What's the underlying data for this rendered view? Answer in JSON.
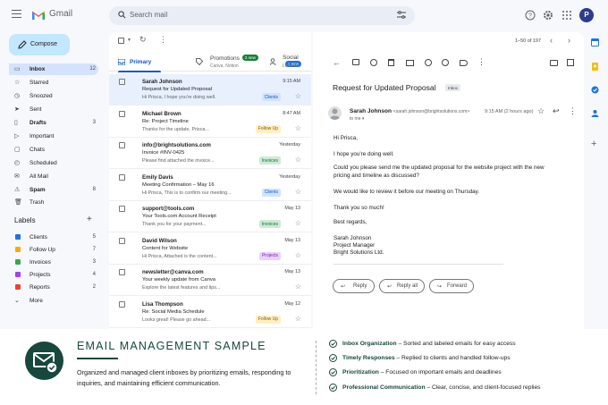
{
  "app": {
    "name": "Gmail",
    "search_placeholder": "Search mail",
    "avatar_letter": "P"
  },
  "sidebar": {
    "compose_label": "Compose",
    "items": [
      {
        "label": "Inbox",
        "count": "12",
        "icon": "inbox-icon",
        "active": true,
        "bold": true
      },
      {
        "label": "Starred",
        "count": "",
        "icon": "star-icon"
      },
      {
        "label": "Snoozed",
        "count": "",
        "icon": "clock-icon"
      },
      {
        "label": "Sent",
        "count": "",
        "icon": "send-icon"
      },
      {
        "label": "Drafts",
        "count": "3",
        "icon": "draft-icon",
        "bold": true
      },
      {
        "label": "Important",
        "count": "",
        "icon": "important-icon"
      },
      {
        "label": "Chats",
        "count": "",
        "icon": "chat-icon"
      },
      {
        "label": "Scheduled",
        "count": "",
        "icon": "scheduled-icon"
      },
      {
        "label": "All Mail",
        "count": "",
        "icon": "mail-icon"
      },
      {
        "label": "Spam",
        "count": "8",
        "icon": "spam-icon",
        "bold": true
      },
      {
        "label": "Trash",
        "count": "",
        "icon": "trash-icon"
      }
    ],
    "labels_heading": "Labels",
    "labels": [
      {
        "label": "Clients",
        "count": "5",
        "color": "#1a73e8"
      },
      {
        "label": "Follow Up",
        "count": "7",
        "color": "#f9ab00"
      },
      {
        "label": "Invoices",
        "count": "3",
        "color": "#34a853"
      },
      {
        "label": "Projects",
        "count": "4",
        "color": "#a142f4"
      },
      {
        "label": "Reports",
        "count": "2",
        "color": "#ea4335"
      }
    ],
    "more_label": "More"
  },
  "inbox": {
    "tabs": [
      {
        "label": "Primary",
        "sub": ""
      },
      {
        "label": "Promotions",
        "sub": "Canva, Notion",
        "badge": "2 new",
        "badge_color": "#188038"
      },
      {
        "label": "Social",
        "sub": "LinkedIn",
        "badge": "1 new",
        "badge_color": "#1a73e8"
      }
    ],
    "emails": [
      {
        "from": "Sarah Johnson",
        "subject": "Request for Updated Proposal",
        "snippet": "Hi Prisca, I hope you're doing well.",
        "time": "9:15 AM",
        "tag": "Clients",
        "tag_bg": "#d3e3fd",
        "tag_fg": "#0b57d0",
        "selected": true
      },
      {
        "from": "Michael Brown",
        "subject": "Re: Project Timeline",
        "snippet": "Thanks for the update, Prisca...",
        "time": "8:47 AM",
        "tag": "Follow Up",
        "tag_bg": "#feefc3",
        "tag_fg": "#8a5a00"
      },
      {
        "from": "info@brightsolutions.com",
        "subject": "Invoice #INV-0425",
        "snippet": "Please find attached the invoice...",
        "time": "Yesterday",
        "tag": "Invoices",
        "tag_bg": "#ceead6",
        "tag_fg": "#137333"
      },
      {
        "from": "Emily Davis",
        "subject": "Meeting Confirmation – May 16",
        "snippet": "Hi Prisca, This is to confirm our meeting...",
        "time": "Yesterday",
        "tag": "Clients",
        "tag_bg": "#d3e3fd",
        "tag_fg": "#0b57d0"
      },
      {
        "from": "support@tools.com",
        "subject": "Your Tools.com Account Receipt",
        "snippet": "Thank you for your payment...",
        "time": "May 13",
        "tag": "Invoices",
        "tag_bg": "#ceead6",
        "tag_fg": "#137333"
      },
      {
        "from": "David Wilson",
        "subject": "Content for Website",
        "snippet": "Hi Prisca, Attached is the content...",
        "time": "May 13",
        "tag": "Projects",
        "tag_bg": "#e9d2fd",
        "tag_fg": "#7b1fa2"
      },
      {
        "from": "newsletter@canva.com",
        "subject": "Your weekly update from Canva",
        "snippet": "Explore the latest features and tips...",
        "time": "May 13",
        "tag": "",
        "tag_bg": "",
        "tag_fg": ""
      },
      {
        "from": "Lisa Thompson",
        "subject": "Re: Social Media Schedule",
        "snippet": "Looks great! Please go ahead...",
        "time": "May 12",
        "tag": "Follow Up",
        "tag_bg": "#feefc3",
        "tag_fg": "#8a5a00"
      }
    ]
  },
  "reader": {
    "pager": "1–50 of 197",
    "subject": "Request for Updated Proposal",
    "folder_chip": "Inbox",
    "sender_name": "Sarah Johnson",
    "sender_email": "<sarah.johnson@brightsolutions.com>",
    "to": "to me",
    "time": "9:15 AM (2 hours ago)",
    "body": [
      "Hi Prisca,",
      "I hope you're doing well.",
      "Could you please send me the updated proposal for the website project with the new pricing and timeline as discussed?",
      "We would like to review it before our meeting on Thursday.",
      "Thank you so much!",
      "Best regards,",
      "Sarah Johnson",
      "Project Manager",
      "Bright Solutions Ltd."
    ],
    "reply_label": "Reply",
    "reply_all_label": "Reply all",
    "forward_label": "Forward"
  },
  "promo": {
    "title": "EMAIL MANAGEMENT SAMPLE",
    "description": "Organized and managed client inboxes by prioritizing emails, responding to inquiries, and maintaining efficient communication.",
    "features": [
      {
        "title": "Inbox Organization",
        "text": " – Sorted and labeled emails for easy access"
      },
      {
        "title": "Timely Responses",
        "text": " – Replied to clients and handled follow-ups"
      },
      {
        "title": "Prioritization",
        "text": " – Focused on important emails and deadlines"
      },
      {
        "title": "Professional Communication",
        "text": " – Clear, concise, and client-focused replies"
      }
    ]
  }
}
